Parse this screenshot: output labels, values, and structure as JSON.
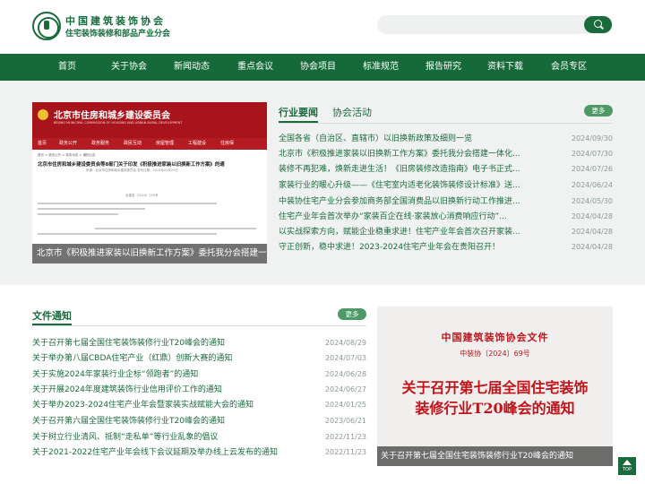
{
  "header": {
    "org_title": "中国建筑装饰协会",
    "org_subtitle": "住宅装饰装修和部品产业分会",
    "search_placeholder": ""
  },
  "nav": {
    "items": [
      "首页",
      "关于协会",
      "新闻动态",
      "重点会议",
      "协会项目",
      "标准规范",
      "报告研究",
      "资料下载",
      "会员专区"
    ]
  },
  "feature": {
    "banner_title": "北京市住房和城乡建设委员会",
    "banner_subtitle": "BEIJING MUNICIPAL COMMISSION OF HOUSING AND URBAN-RURAL DEVELOPMENT",
    "banner_nav": [
      "首页",
      "政务公开",
      "政务服务",
      "政民互动",
      "房屋管理",
      "工程建设",
      "住房保"
    ],
    "crumb": "首页 > 政务公开 > 政务动态 > 通知公告",
    "doc_title": "北京市住房和城乡建设委员会等8部门关于印发《积极推进家装以旧换新工作方案》的通",
    "doc_meta": "来源：北京市住房和城乡建设委员会   发布日期：2024年07月29日",
    "doc_number": "京建发〔2024〕259号",
    "caption": "北京市《积极推进家装以旧换新工作方案》委托我分会搭建一体化..."
  },
  "news": {
    "tab_active": "行业要闻",
    "tab_inactive": "协会活动",
    "more_label": "更多",
    "items": [
      {
        "title": "全国各省（自治区、直辖市）以旧换新政策及细则一览",
        "date": "2024/09/30"
      },
      {
        "title": "北京市《积极推进家装以旧换新工作方案》委托我分会搭建一体化...",
        "date": "2024/07/30"
      },
      {
        "title": "装修不再犯难，焕新走进生活！《旧房装修改造指南》电子书正式...",
        "date": "2024/07/26"
      },
      {
        "title": "家装行业的暖心升级——《住宅室内适老化装饰装修设计标准》送...",
        "date": "2024/06/24"
      },
      {
        "title": "中装协住宅产业分会参加商务部全国消费品以旧换新行动工作推进...",
        "date": "2024/05/30"
      },
      {
        "title": "住宅产业年会首次举办“家装百企在线·家装放心消费响应行动”...",
        "date": "2024/04/28"
      },
      {
        "title": "以实战探索方向，赋能企业稳重求进！住宅产业年会首次召开家装...",
        "date": "2024/04/28"
      },
      {
        "title": "守正创新，稳中求进！2023-2024住宅产业年会在贵阳召开！",
        "date": "2024/04/28"
      }
    ]
  },
  "files": {
    "title": "文件通知",
    "more_label": "更多",
    "items": [
      {
        "title": "关于召开第七届全国住宅装饰装修行业T20峰会的通知",
        "date": "2024/08/29"
      },
      {
        "title": "关于举办第八届CBDA住宅产业（红鼎）创新大赛的通知",
        "date": "2024/07/03"
      },
      {
        "title": "关于实施2024年家装行业企标“领跑者”的通知",
        "date": "2024/06/28"
      },
      {
        "title": "关于开展2024年度建筑装饰行业信用评价工作的通知",
        "date": "2024/06/27"
      },
      {
        "title": "关于举办2023-2024住宅产业年会暨家装实战赋能大会的通知",
        "date": "2024/01/25"
      },
      {
        "title": "关于召开第六届全国住宅装饰装修行业T20峰会的通知",
        "date": "2023/06/21"
      },
      {
        "title": "关于树立行业清风、抵制“走私单”等行业乱象的倡议",
        "date": "2022/11/23"
      },
      {
        "title": "关于2021-2022住宅产业年会线下会议延期及举办线上云发布的通知",
        "date": "2022/11/23"
      }
    ]
  },
  "doc_image": {
    "org": "中国建筑装饰协会文件",
    "number": "中装协〔2024〕69号",
    "headline_1": "关于召开第七届全国住宅装饰",
    "headline_2": "装修行业T20峰会的通知",
    "caption": "关于召开第七届全国住宅装饰装修行业T20峰会的通知"
  },
  "back_to_top": "TOP",
  "colors": {
    "brand_green": "#1a6b3c",
    "nav_green": "#166a3a",
    "doc_red": "#c0141a"
  }
}
